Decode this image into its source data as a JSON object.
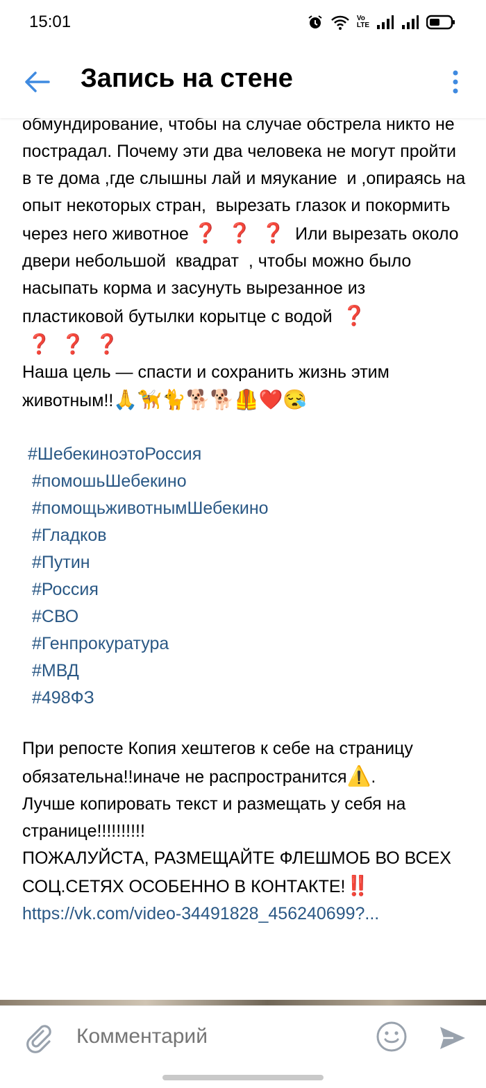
{
  "status_bar": {
    "time": "15:01",
    "icons": [
      "alarm-icon",
      "wifi-icon",
      "volte-icon",
      "signal-icon",
      "signal-icon",
      "battery-icon"
    ],
    "volte_label": "Vo\nLTE"
  },
  "header": {
    "title": "Запись на стене",
    "back_icon": "arrow-left-icon",
    "more_icon": "more-vertical-icon",
    "accent": "#3f8ae0"
  },
  "post": {
    "paragraph_1": "обмундирование, чтобы на случае обстрела никто не пострадал. Почему эти два человека не могут пройти в те дома ,где слышны лай и мяукание  и ,опираясь на опыт некоторых стран,  вырезать глазок и покормить через него животное",
    "qm_glyph": "❓",
    "paragraph_2": "  Или вырезать около двери небольшой  квадрат  , чтобы можно было насыпать корма и засунуть вырезанное из пластиковой бутылки корытце с водой  ",
    "paragraph_3": "Наша цель — спасти и сохранить жизнь этим животным!!",
    "emoji_tail": "🙏🦮🐈🐕🐕🦺❤️😪",
    "hashtags": [
      "#ШебекиноэтоРоссия",
      "#помошьШебекино",
      "#помощьживотнымШебекино",
      "#Гладков",
      "#Путин",
      "#Россия",
      "#СВО",
      "#Генпрокуратура",
      "#МВД",
      "#498ФЗ"
    ],
    "repost_note_1": "При репосте Копия хештегов к себе на страницу обязательна!!иначе не распространится",
    "warning_emoji": "⚠️",
    "repost_note_1_end": ".",
    "repost_note_2": "Лучше копировать текст и размещать у себя на странице!!!!!!!!!!",
    "repost_note_3": "ПОЖАЛУЙСТА, РАЗМЕЩАЙТЕ ФЛЕШМОБ ВО ВСЕХ СОЦ.СЕТЯХ ОСОБЕННО В КОНТАКТЕ!",
    "double_exclamation": "‼️",
    "link": "https://vk.com/video-34491828_456240699?...",
    "link_color": "#2a5885"
  },
  "comment_bar": {
    "placeholder": "Комментарий",
    "attach_icon": "paperclip-icon",
    "emoji_icon": "smile-icon",
    "send_icon": "send-icon"
  }
}
